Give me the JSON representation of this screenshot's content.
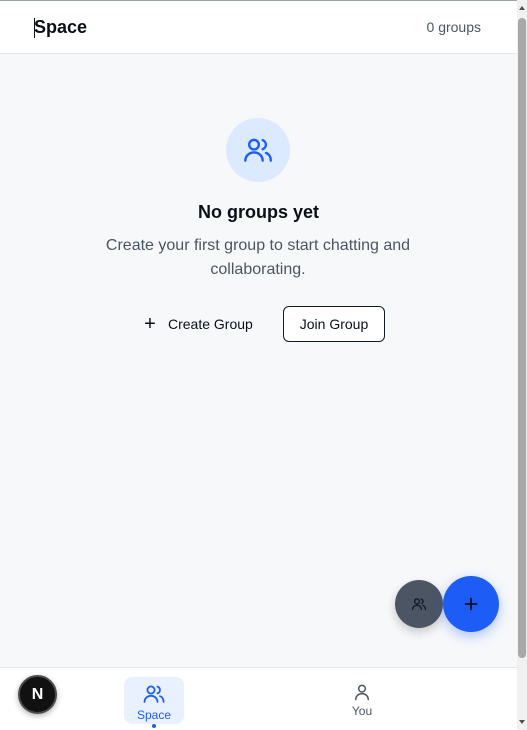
{
  "header": {
    "title": "Space",
    "group_count": "0 groups"
  },
  "empty_state": {
    "icon": "users-icon",
    "title": "No groups yet",
    "description": "Create your first group to start chatting and collaborating.",
    "create_label": "Create Group",
    "join_label": "Join Group"
  },
  "fabs": {
    "groups_icon": "users-icon",
    "add_icon": "plus-icon"
  },
  "bottom_nav": {
    "items": [
      {
        "label": "Space",
        "icon": "users-icon",
        "active": true
      },
      {
        "label": "You",
        "icon": "user-icon",
        "active": false
      }
    ]
  },
  "dev_badge": {
    "letter": "N"
  },
  "colors": {
    "accent": "#1d5cf5",
    "accent_light": "#dbeafe",
    "background": "#f7f8fa",
    "fab_secondary": "#4b5563"
  }
}
